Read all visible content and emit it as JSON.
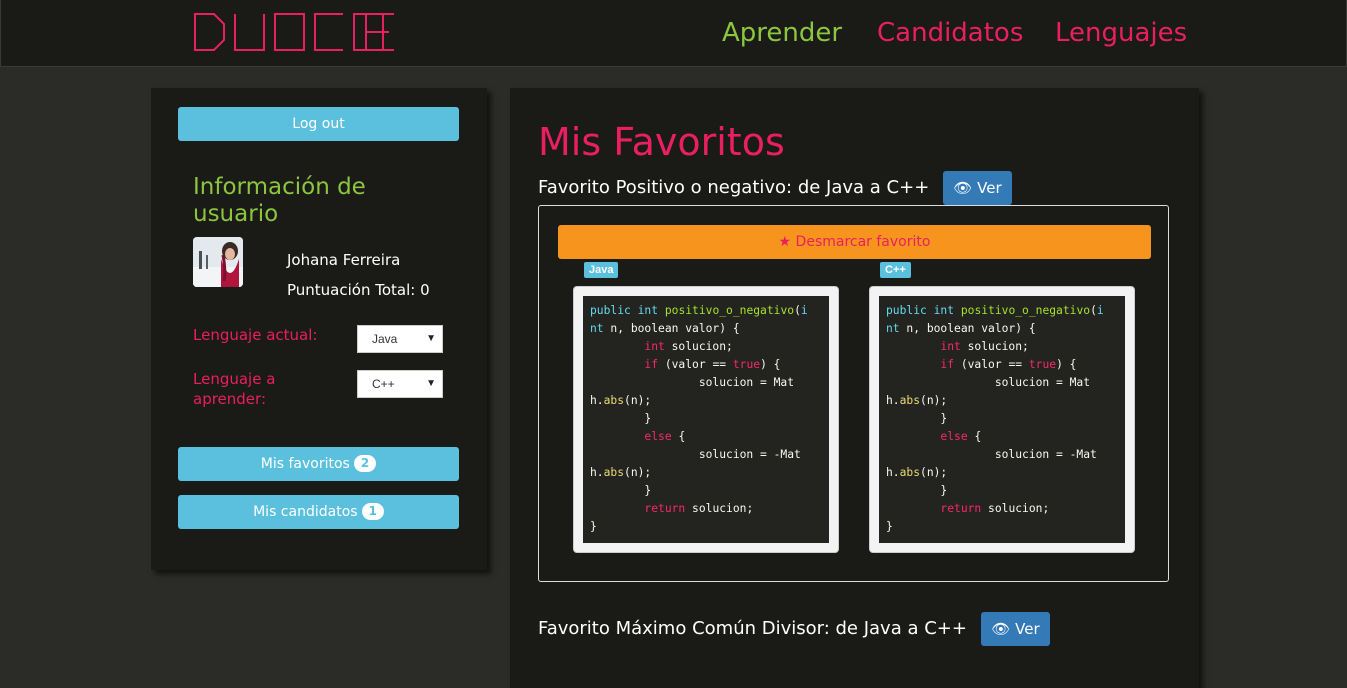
{
  "brand": {
    "logo_text": "DUOCODE",
    "colors": {
      "pink": "#ea1e63",
      "green": "#8cc63f",
      "blue": "#5bc0de"
    }
  },
  "nav": {
    "learn": "Aprender",
    "candidates": "Candidatos",
    "languages": "Lenguajes"
  },
  "sidebar": {
    "logout": "Log out",
    "info_title": "Información de usuario",
    "user_name": "Johana Ferreira",
    "score_label": "Puntuación Total: 0",
    "current_lang_label": "Lenguaje actual:",
    "current_lang_value": "Java",
    "learn_lang_label": "Lenguaje a aprender:",
    "learn_lang_value": "C++",
    "favorites_label": "Mis favoritos",
    "favorites_count": "2",
    "candidates_label": "Mis candidatos",
    "candidates_count": "1"
  },
  "main": {
    "title": "Mis Favoritos",
    "favorites": [
      {
        "title": "Favorito Positivo o negativo: de Java a C++",
        "view_label": "Ver",
        "unmark_label": "Desmarcar favorito",
        "from_lang": "Java",
        "to_lang": "C++"
      },
      {
        "title": "Favorito Máximo Común Divisor: de Java a C++",
        "view_label": "Ver"
      }
    ]
  }
}
